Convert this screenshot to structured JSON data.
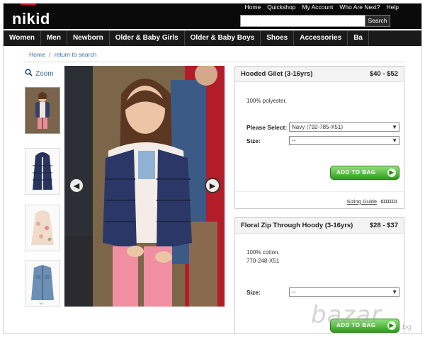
{
  "brand": {
    "logo": "nikid"
  },
  "top_links": [
    "Home",
    "Quickshop",
    "My Account",
    "Who Are Next?",
    "Help"
  ],
  "search": {
    "button": "Search",
    "placeholder": ""
  },
  "nav": [
    "Women",
    "Men",
    "Newborn",
    "Older & Baby Girls",
    "Older & Baby Boys",
    "Shoes",
    "Accessories",
    "Ba"
  ],
  "breadcrumb": {
    "home": "Home",
    "sep": "/",
    "back": "return to search"
  },
  "zoom": {
    "label": "Zoom"
  },
  "thumbnails": [
    "outfit",
    "gilet",
    "floral-hoody",
    "denim-shirt"
  ],
  "products": [
    {
      "name": "Hooded Gilet (3-16yrs)",
      "price": "$40 - $52",
      "description": "100% polyester.",
      "select_label": "Please Select:",
      "select_value": "Navy (792-785-X51)",
      "size_label": "Size:",
      "size_value": "--",
      "add_button": "ADD TO BAG",
      "sizing_link": "Sizing Guide"
    },
    {
      "name": "Floral Zip Through Hoody (3-16yrs)",
      "price": "$28 - $37",
      "description": "100% cotton.",
      "code": "770-248-X51",
      "size_label": "Size:",
      "size_value": "--",
      "add_button": "ADD TO BAG"
    }
  ],
  "watermark": {
    "main": "bazar",
    "suffix": ".bg"
  },
  "colors": {
    "header_bg": "#0a0a0a",
    "nav_bg": "#1a1a1a",
    "accent_link": "#3b6ea5",
    "add_button": "#2f9d1c",
    "brand_red": "#c8102e"
  }
}
